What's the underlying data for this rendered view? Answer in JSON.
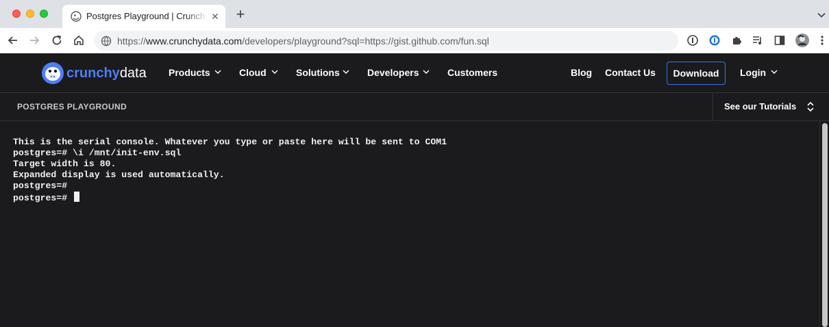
{
  "browser": {
    "tab_title": "Postgres Playground | Crunchy",
    "new_tab_symbol": "+",
    "close_symbol": "✕",
    "url_scheme": "https://",
    "url_host": "www.crunchydata.com",
    "url_path": "/developers/playground?sql=https://gist.github.com/fun.sql"
  },
  "site": {
    "logo_word1": "crunchy",
    "logo_word2": "data",
    "nav": [
      {
        "label": "Products"
      },
      {
        "label": "Cloud"
      },
      {
        "label": "Solutions"
      },
      {
        "label": "Developers"
      },
      {
        "label": "Customers"
      }
    ],
    "right_nav": {
      "blog": "Blog",
      "contact": "Contact Us",
      "download": "Download",
      "login": "Login"
    },
    "brand_color": "#4f7ef5"
  },
  "subheader": {
    "title": "POSTGRES PLAYGROUND",
    "tutorials": "See our Tutorials"
  },
  "console": {
    "lines": [
      "This is the serial console. Whatever you type or paste here will be sent to COM1",
      "postgres=# \\i /mnt/init-env.sql",
      "Target width is 80.",
      "Expanded display is used automatically.",
      "postgres=#",
      "postgres=# "
    ]
  }
}
